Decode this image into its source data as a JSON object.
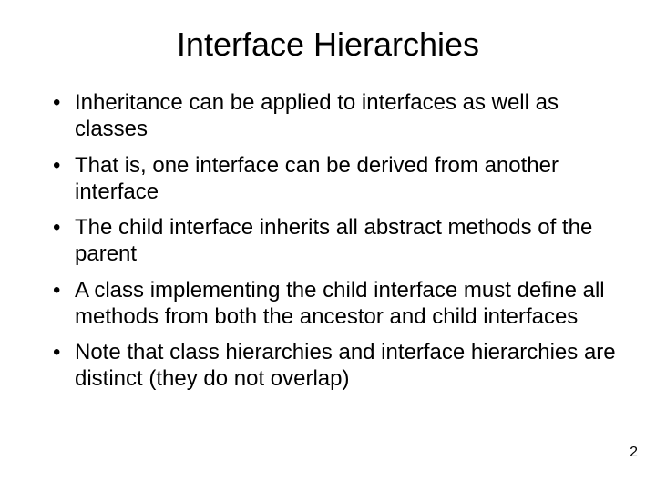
{
  "title": "Interface Hierarchies",
  "bullets": [
    "Inheritance can be applied to interfaces as well as classes",
    "That is, one interface can be derived from another interface",
    "The child interface inherits all abstract methods of the parent",
    "A class implementing the child interface must define all methods from both the ancestor and child interfaces",
    "Note that class hierarchies and interface hierarchies are distinct (they do not overlap)"
  ],
  "page_number": "2"
}
